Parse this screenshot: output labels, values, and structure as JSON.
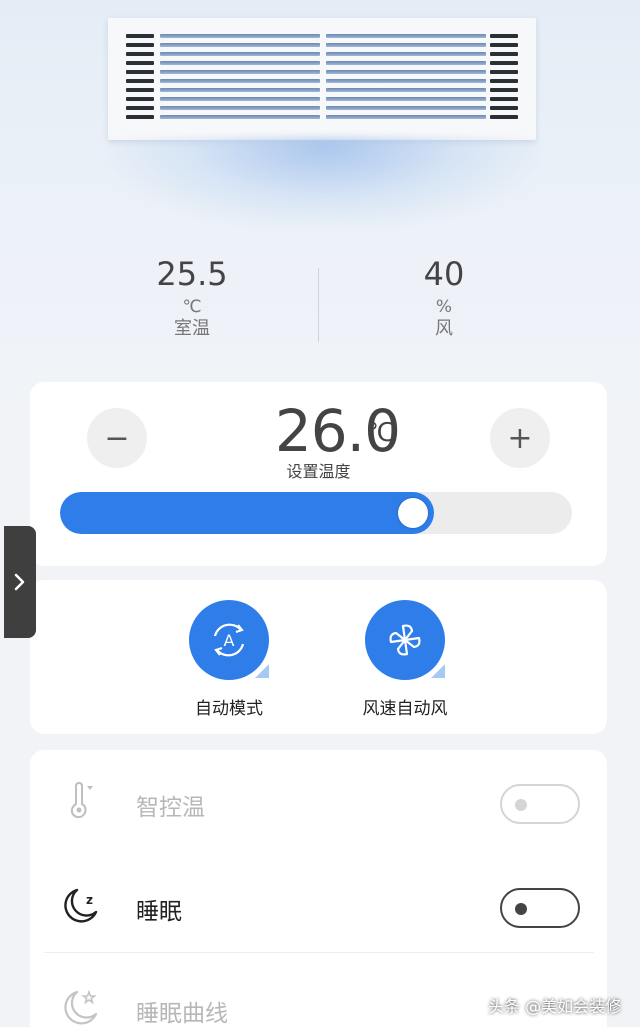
{
  "status": {
    "room_temp": {
      "value": "25.5",
      "unit": "℃",
      "label": "室温"
    },
    "wind": {
      "value": "40",
      "unit": "%",
      "label": "风"
    }
  },
  "setpoint": {
    "minus_label": "−",
    "plus_label": "+",
    "value": "26.0",
    "unit": "℃",
    "label": "设置温度",
    "slider_fraction": 0.73
  },
  "modes": [
    {
      "label": "自动模式",
      "icon": "auto-mode-icon"
    },
    {
      "label": "风速自动风",
      "icon": "fan-icon"
    }
  ],
  "side_tab": {
    "icon": "chevron-right-icon"
  },
  "switches": [
    {
      "label": "智控温",
      "icon": "thermometer-icon",
      "enabled": false,
      "on": false
    },
    {
      "label": "睡眠",
      "icon": "moon-zz-icon",
      "enabled": true,
      "on": false
    },
    {
      "label": "睡眠曲线",
      "icon": "moon-star-icon",
      "enabled": false,
      "on": false
    }
  ],
  "colors": {
    "accent": "#2f7de9",
    "card": "#ffffff",
    "disabled_text": "#b7b7b7"
  },
  "watermark": "头条 @美如会装修"
}
